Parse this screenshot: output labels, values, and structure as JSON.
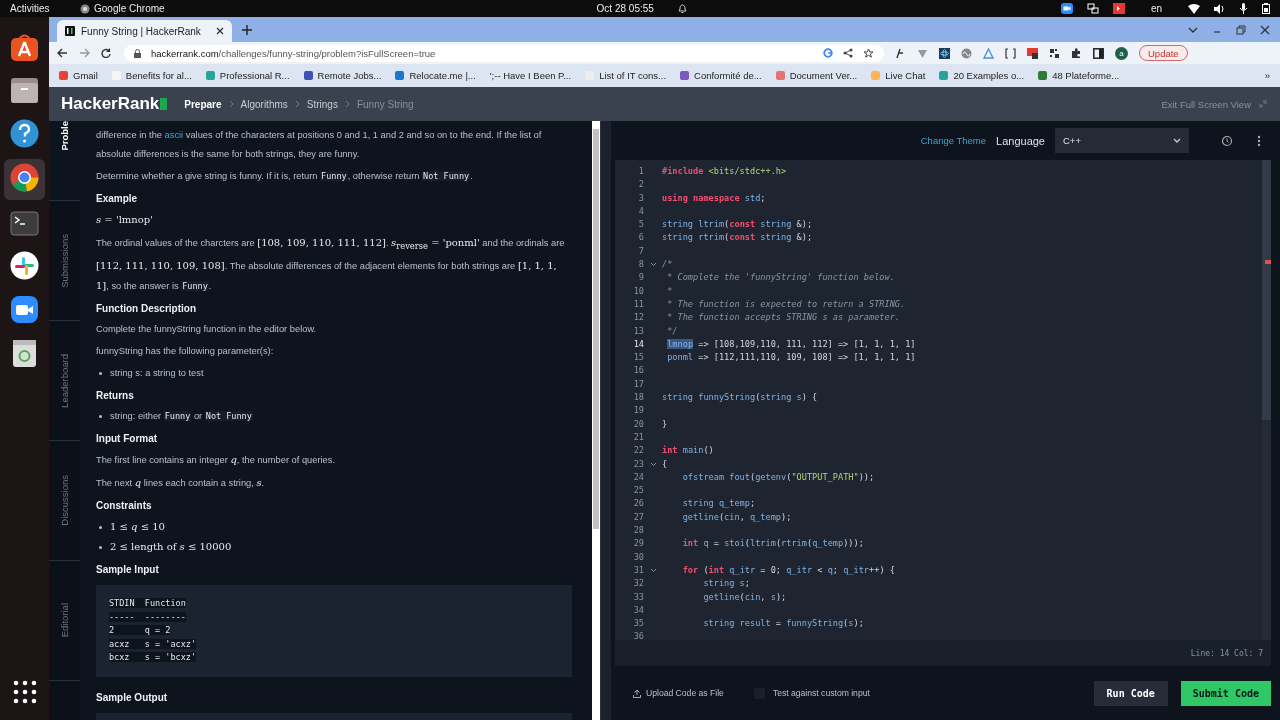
{
  "topbar": {
    "activities": "Activities",
    "app": "Google Chrome",
    "clock": "Oct 28  05:55",
    "lang": "en"
  },
  "browser": {
    "tabs": [
      {
        "title": "Funny String | HackerRank",
        "selected": true
      }
    ],
    "url_host": "hackerrank.com",
    "url_path": "/challenges/funny-string/problem?isFullScreen=true",
    "avatar": "a",
    "update": "Update",
    "bookmarks": [
      {
        "label": "Gmail",
        "color": "#ea4335"
      },
      {
        "label": "Benefits for al...",
        "color": "#f5f5f5"
      },
      {
        "label": "Professional R...",
        "color": "#26a69a"
      },
      {
        "label": "Remote Jobs...",
        "color": "#3f51b5"
      },
      {
        "label": "Relocate.me |...",
        "color": "#1976d2"
      },
      {
        "label": "';--  Have I Been P..."
      },
      {
        "label": "List of IT cons...",
        "color": "#eeeeee"
      },
      {
        "label": "Conformité de...",
        "color": "#7e57c2"
      },
      {
        "label": "Document Ver...",
        "color": "#e57373"
      },
      {
        "label": "Live Chat",
        "color": "#ffb74d"
      },
      {
        "label": "20 Examples o...",
        "color": "#26a69a"
      },
      {
        "label": "48 Plateforme...",
        "color": "#2e7d32"
      }
    ],
    "bookmarks_more": "»"
  },
  "site": {
    "logo": "HackerRank",
    "breadcrumbs": [
      "Prepare",
      "Algorithms",
      "Strings",
      "Funny String"
    ],
    "exit": "Exit Full Screen View"
  },
  "side_tabs": [
    {
      "label": "Proble",
      "selected": true
    },
    {
      "label": "Submissions",
      "selected": false
    },
    {
      "label": "Leaderboard",
      "selected": false
    },
    {
      "label": "Discussions",
      "selected": false
    },
    {
      "label": "Editorial",
      "selected": false
    }
  ],
  "problem": [
    {
      "kind": "para",
      "segments": [
        {
          "kind": "text",
          "text": "difference in the "
        },
        {
          "kind": "link",
          "text": "ascii"
        },
        {
          "kind": "text",
          "text": " values of the characters at positions 0 and 1, 1 and 2 and so on to the end. If the list of absolute differences is the same for both strings, they are funny."
        }
      ]
    },
    {
      "kind": "para",
      "segments": [
        {
          "kind": "text",
          "text": "Determine whether a give string is funny. If it is, return "
        },
        {
          "kind": "code",
          "text": "Funny"
        },
        {
          "kind": "text",
          "text": ", otherwise return "
        },
        {
          "kind": "code",
          "text": "Not Funny"
        },
        {
          "kind": "text",
          "text": "."
        }
      ]
    },
    {
      "kind": "heading",
      "text": "Example"
    },
    {
      "kind": "para",
      "segments": [
        {
          "kind": "math",
          "text": "*s* = 'lmnop'"
        }
      ]
    },
    {
      "kind": "para",
      "segments": [
        {
          "kind": "text",
          "text": "The ordinal values of the charcters are "
        },
        {
          "kind": "math",
          "text": "[108, 109, 110, 111, 112]"
        },
        {
          "kind": "text",
          "text": ". "
        },
        {
          "kind": "math",
          "text": "*s*$_{reverse}$ = 'ponml'"
        },
        {
          "kind": "text",
          "text": " and the ordinals are "
        },
        {
          "kind": "math",
          "text": "[112, 111, 110, 109, 108]"
        },
        {
          "kind": "text",
          "text": ". The absolute differences of the adjacent elements for both strings are "
        },
        {
          "kind": "math",
          "text": "[1, 1, 1, 1]"
        },
        {
          "kind": "text",
          "text": ", so the answer is "
        },
        {
          "kind": "code",
          "text": "Funny"
        },
        {
          "kind": "text",
          "text": "."
        }
      ]
    },
    {
      "kind": "heading",
      "text": "Function Description"
    },
    {
      "kind": "para",
      "segments": [
        {
          "kind": "text",
          "text": "Complete the funnyString function in the editor below."
        }
      ]
    },
    {
      "kind": "para",
      "segments": [
        {
          "kind": "text",
          "text": "funnyString has the following parameter(s):"
        }
      ]
    },
    {
      "kind": "bullets",
      "items": [
        [
          {
            "kind": "text",
            "text": "string s: a string to test"
          }
        ]
      ]
    },
    {
      "kind": "heading",
      "text": "Returns"
    },
    {
      "kind": "bullets",
      "items": [
        [
          {
            "kind": "text",
            "text": "string: either "
          },
          {
            "kind": "code",
            "text": "Funny"
          },
          {
            "kind": "text",
            "text": " or "
          },
          {
            "kind": "code",
            "text": "Not Funny"
          }
        ]
      ]
    },
    {
      "kind": "heading",
      "text": "Input Format"
    },
    {
      "kind": "para",
      "segments": [
        {
          "kind": "text",
          "text": "The first line contains an integer "
        },
        {
          "kind": "math",
          "text": "*q*"
        },
        {
          "kind": "text",
          "text": ", the number of queries."
        }
      ]
    },
    {
      "kind": "para",
      "segments": [
        {
          "kind": "text",
          "text": "The next "
        },
        {
          "kind": "math",
          "text": "*q*"
        },
        {
          "kind": "text",
          "text": " lines each contain a string, "
        },
        {
          "kind": "math",
          "text": "*s*"
        },
        {
          "kind": "text",
          "text": "."
        }
      ]
    },
    {
      "kind": "heading",
      "text": "Constraints"
    },
    {
      "kind": "bullets",
      "items": [
        [
          {
            "kind": "math",
            "text": "1 ≤ *q* ≤ 10"
          }
        ],
        [
          {
            "kind": "math",
            "text": "2 ≤ length of *s* ≤ 10000"
          }
        ]
      ]
    },
    {
      "kind": "heading",
      "text": "Sample Input"
    },
    {
      "kind": "pre",
      "lines": [
        "STDIN  Function",
        "-----  --------",
        "2      q = 2",
        "acxz   s = 'acxz'",
        "bcxz   s = 'bcxz'"
      ]
    },
    {
      "kind": "heading",
      "text": "Sample Output"
    },
    {
      "kind": "pre_cut"
    }
  ],
  "editor": {
    "change_theme": "Change Theme",
    "language_label": "Language",
    "language": "C++",
    "lines": [
      {
        "n": "1",
        "fold": false,
        "current": false,
        "code": [
          {
            "kind": "kw",
            "text": "#include "
          },
          {
            "kind": "str",
            "text": "<bits/stdc++.h>"
          }
        ]
      },
      {
        "n": "2",
        "fold": false,
        "current": false
      },
      {
        "n": "3",
        "fold": false,
        "current": false,
        "code": [
          {
            "kind": "kw",
            "text": "using namespace "
          },
          {
            "kind": "id",
            "text": "std"
          },
          {
            "kind": "pu",
            "text": ";"
          }
        ]
      },
      {
        "n": "4",
        "fold": false,
        "current": false
      },
      {
        "n": "5",
        "fold": false,
        "current": false,
        "code": [
          {
            "kind": "id",
            "text": "string ltrim"
          },
          {
            "kind": "pu",
            "text": "("
          },
          {
            "kind": "kw",
            "text": "const "
          },
          {
            "kind": "id",
            "text": "string "
          },
          {
            "kind": "pu",
            "text": "&);"
          }
        ]
      },
      {
        "n": "6",
        "fold": false,
        "current": false,
        "code": [
          {
            "kind": "id",
            "text": "string rtrim"
          },
          {
            "kind": "pu",
            "text": "("
          },
          {
            "kind": "kw",
            "text": "const "
          },
          {
            "kind": "id",
            "text": "string "
          },
          {
            "kind": "pu",
            "text": "&);"
          }
        ]
      },
      {
        "n": "7",
        "fold": false,
        "current": false
      },
      {
        "n": "8",
        "fold": true,
        "current": false,
        "code": [
          {
            "kind": "cm",
            "text": "/*"
          }
        ]
      },
      {
        "n": "9",
        "fold": false,
        "current": false,
        "code": [
          {
            "kind": "cm",
            "text": " * Complete the 'funnyString' function below."
          }
        ]
      },
      {
        "n": "10",
        "fold": false,
        "current": false,
        "code": [
          {
            "kind": "cm",
            "text": " *"
          }
        ]
      },
      {
        "n": "11",
        "fold": false,
        "current": false,
        "code": [
          {
            "kind": "cm",
            "text": " * The function is expected to return a STRING."
          }
        ]
      },
      {
        "n": "12",
        "fold": false,
        "current": false,
        "code": [
          {
            "kind": "cm",
            "text": " * The function accepts STRING s as parameter."
          }
        ]
      },
      {
        "n": "13",
        "fold": false,
        "current": false,
        "code": [
          {
            "kind": "cm",
            "text": " */"
          }
        ]
      },
      {
        "n": "14",
        "fold": false,
        "current": true,
        "code": [
          {
            "kind": "sel",
            "text": " lmnop"
          },
          {
            "kind": "pu",
            "text": " => [108,109,110, 111, 112] => [1, 1, 1, 1]"
          }
        ]
      },
      {
        "n": "15",
        "fold": false,
        "current": false,
        "code": [
          {
            "kind": "id",
            "text": " ponml"
          },
          {
            "kind": "pu",
            "text": " => [112,111,110, 109, 108] => [1, 1, 1, 1]"
          }
        ]
      },
      {
        "n": "16",
        "fold": false,
        "current": false
      },
      {
        "n": "17",
        "fold": false,
        "current": false
      },
      {
        "n": "18",
        "fold": false,
        "current": false,
        "code": [
          {
            "kind": "id",
            "text": "string funnyString"
          },
          {
            "kind": "pu",
            "text": "("
          },
          {
            "kind": "id",
            "text": "string s"
          },
          {
            "kind": "pu",
            "text": ") {"
          }
        ]
      },
      {
        "n": "19",
        "fold": false,
        "current": false
      },
      {
        "n": "20",
        "fold": false,
        "current": false,
        "code": [
          {
            "kind": "pu",
            "text": "}"
          }
        ]
      },
      {
        "n": "21",
        "fold": false,
        "current": false
      },
      {
        "n": "22",
        "fold": false,
        "current": false,
        "code": [
          {
            "kind": "kw",
            "text": "int "
          },
          {
            "kind": "id",
            "text": "main"
          },
          {
            "kind": "pu",
            "text": "()"
          }
        ]
      },
      {
        "n": "23",
        "fold": true,
        "current": false,
        "code": [
          {
            "kind": "pu",
            "text": "{"
          }
        ]
      },
      {
        "n": "24",
        "fold": false,
        "current": false,
        "code": [
          {
            "kind": "id",
            "text": "    ofstream fout"
          },
          {
            "kind": "pu",
            "text": "("
          },
          {
            "kind": "id",
            "text": "getenv"
          },
          {
            "kind": "pu",
            "text": "("
          },
          {
            "kind": "str",
            "text": "\"OUTPUT_PATH\""
          },
          {
            "kind": "pu",
            "text": "));"
          }
        ]
      },
      {
        "n": "25",
        "fold": false,
        "current": false
      },
      {
        "n": "26",
        "fold": false,
        "current": false,
        "code": [
          {
            "kind": "id",
            "text": "    string q_temp"
          },
          {
            "kind": "pu",
            "text": ";"
          }
        ]
      },
      {
        "n": "27",
        "fold": false,
        "current": false,
        "code": [
          {
            "kind": "id",
            "text": "    getline"
          },
          {
            "kind": "pu",
            "text": "("
          },
          {
            "kind": "id",
            "text": "cin"
          },
          {
            "kind": "pu",
            "text": ", "
          },
          {
            "kind": "id",
            "text": "q_temp"
          },
          {
            "kind": "pu",
            "text": ");"
          }
        ]
      },
      {
        "n": "28",
        "fold": false,
        "current": false
      },
      {
        "n": "29",
        "fold": false,
        "current": false,
        "code": [
          {
            "kind": "kw",
            "text": "    int "
          },
          {
            "kind": "id",
            "text": "q "
          },
          {
            "kind": "pu",
            "text": "= "
          },
          {
            "kind": "id",
            "text": "stoi"
          },
          {
            "kind": "pu",
            "text": "("
          },
          {
            "kind": "id",
            "text": "ltrim"
          },
          {
            "kind": "pu",
            "text": "("
          },
          {
            "kind": "id",
            "text": "rtrim"
          },
          {
            "kind": "pu",
            "text": "("
          },
          {
            "kind": "id",
            "text": "q_temp"
          },
          {
            "kind": "pu",
            "text": ")));"
          }
        ]
      },
      {
        "n": "30",
        "fold": false,
        "current": false
      },
      {
        "n": "31",
        "fold": true,
        "current": false,
        "code": [
          {
            "kind": "kw",
            "text": "    for "
          },
          {
            "kind": "pu",
            "text": "("
          },
          {
            "kind": "kw",
            "text": "int "
          },
          {
            "kind": "id",
            "text": "q_itr "
          },
          {
            "kind": "pu",
            "text": "= 0; "
          },
          {
            "kind": "id",
            "text": "q_itr "
          },
          {
            "kind": "pu",
            "text": "< "
          },
          {
            "kind": "id",
            "text": "q"
          },
          {
            "kind": "pu",
            "text": "; "
          },
          {
            "kind": "id",
            "text": "q_itr"
          },
          {
            "kind": "pu",
            "text": "++) {"
          }
        ]
      },
      {
        "n": "32",
        "fold": false,
        "current": false,
        "code": [
          {
            "kind": "id",
            "text": "        string s"
          },
          {
            "kind": "pu",
            "text": ";"
          }
        ]
      },
      {
        "n": "33",
        "fold": false,
        "current": false,
        "code": [
          {
            "kind": "id",
            "text": "        getline"
          },
          {
            "kind": "pu",
            "text": "("
          },
          {
            "kind": "id",
            "text": "cin"
          },
          {
            "kind": "pu",
            "text": ", "
          },
          {
            "kind": "id",
            "text": "s"
          },
          {
            "kind": "pu",
            "text": ");"
          }
        ]
      },
      {
        "n": "34",
        "fold": false,
        "current": false
      },
      {
        "n": "35",
        "fold": false,
        "current": false,
        "code": [
          {
            "kind": "id",
            "text": "        string result "
          },
          {
            "kind": "pu",
            "text": "= "
          },
          {
            "kind": "id",
            "text": "funnyString"
          },
          {
            "kind": "pu",
            "text": "("
          },
          {
            "kind": "id",
            "text": "s"
          },
          {
            "kind": "pu",
            "text": ");"
          }
        ]
      },
      {
        "n": "36",
        "fold": false,
        "current": false
      }
    ],
    "status": "Line: 14 Col: 7",
    "upload": "Upload Code as File",
    "custom_input": {
      "label": "Test against custom input",
      "checked": false
    },
    "run": "Run Code",
    "submit": "Submit Code"
  }
}
